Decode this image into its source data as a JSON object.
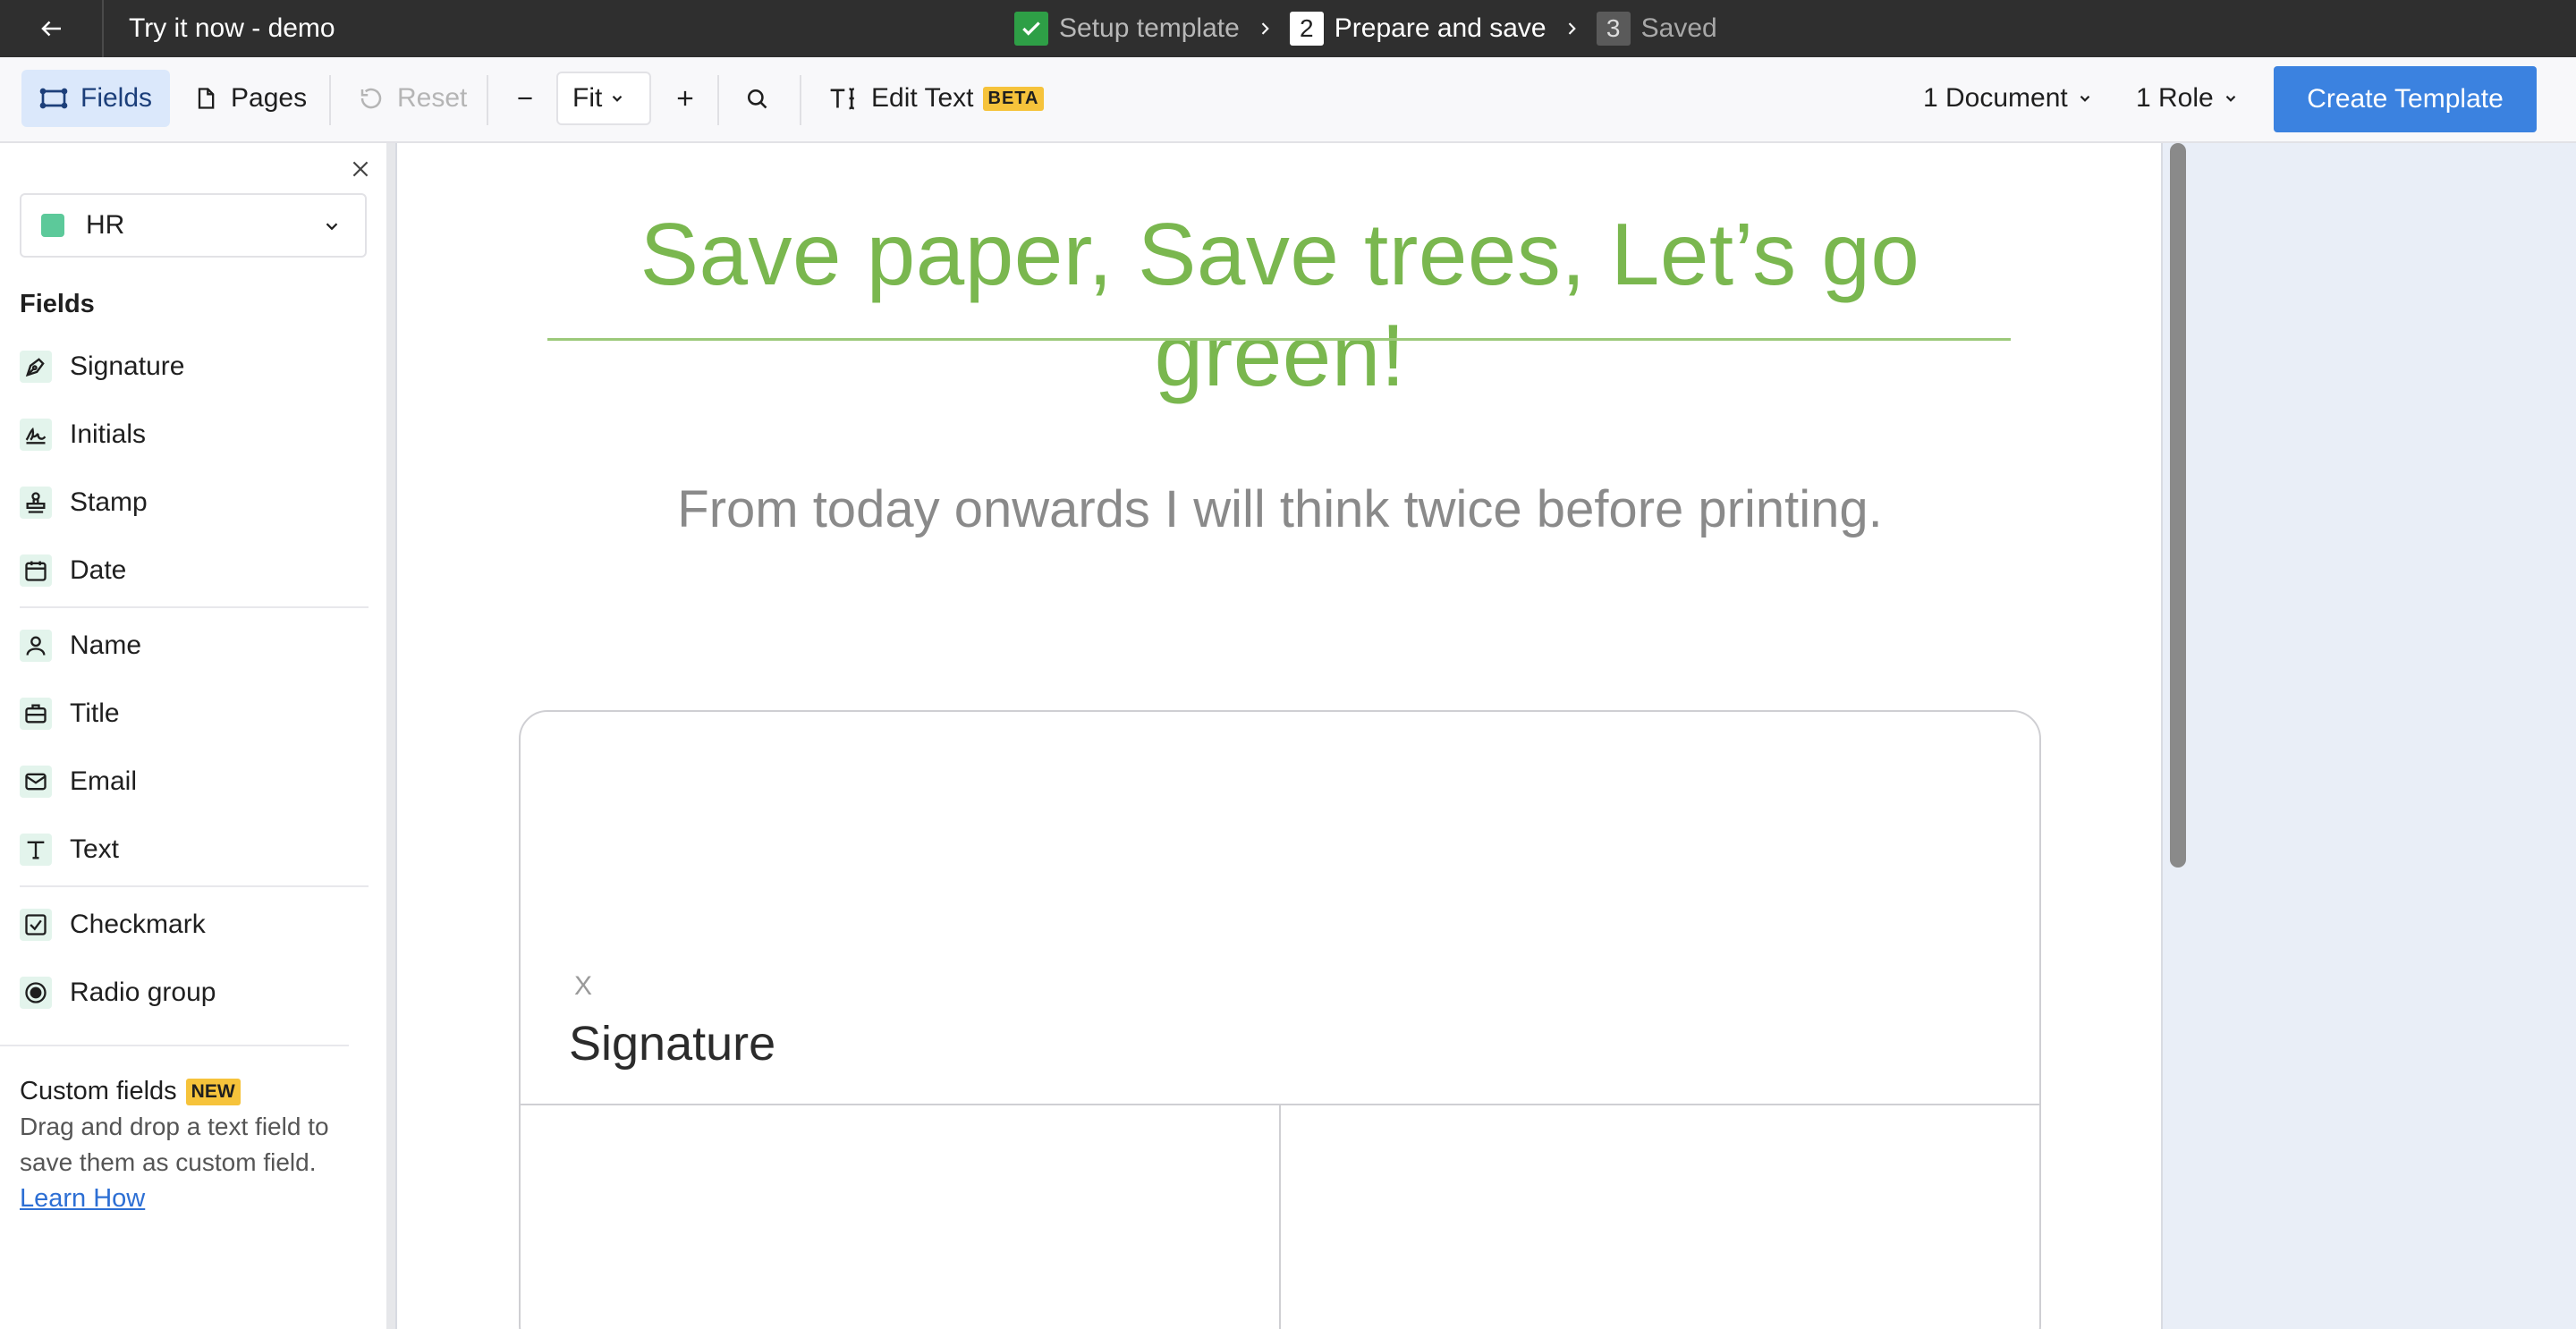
{
  "topbar": {
    "title": "Try it now - demo",
    "steps": [
      {
        "number": "",
        "label": "Setup template",
        "state": "done"
      },
      {
        "number": "2",
        "label": "Prepare and save",
        "state": "active"
      },
      {
        "number": "3",
        "label": "Saved",
        "state": "pending"
      }
    ]
  },
  "toolbar": {
    "fields_label": "Fields",
    "pages_label": "Pages",
    "reset_label": "Reset",
    "zoom_value": "Fit",
    "edit_text_label": "Edit Text",
    "edit_text_badge": "BETA",
    "documents_label": "1 Document",
    "roles_label": "1 Role",
    "create_label": "Create Template"
  },
  "sidebar": {
    "role": {
      "name": "HR",
      "color": "#5cc99a"
    },
    "heading": "Fields",
    "fields": [
      {
        "label": "Signature",
        "icon": "pen-nib-icon"
      },
      {
        "label": "Initials",
        "icon": "initials-icon"
      },
      {
        "label": "Stamp",
        "icon": "stamp-icon"
      },
      {
        "label": "Date",
        "icon": "calendar-icon"
      },
      {
        "label": "Name",
        "icon": "person-icon"
      },
      {
        "label": "Title",
        "icon": "briefcase-icon"
      },
      {
        "label": "Email",
        "icon": "envelope-icon"
      },
      {
        "label": "Text",
        "icon": "text-icon"
      },
      {
        "label": "Checkmark",
        "icon": "checkbox-icon"
      },
      {
        "label": "Radio group",
        "icon": "radio-icon"
      }
    ],
    "custom_fields": {
      "title": "Custom fields",
      "badge": "NEW",
      "description": "Drag and drop a text field to save them as custom field.",
      "link": "Learn How"
    }
  },
  "document": {
    "heading": "Save paper, Save trees, Let’s go green!",
    "subheading": "From today onwards I will think twice before printing.",
    "signature_x": "X",
    "signature_label": "Signature"
  },
  "colors": {
    "accent": "#3b82e0",
    "heading_green": "#7ab74f",
    "topbar": "#2f2f2f",
    "step_done": "#2e9f46"
  }
}
